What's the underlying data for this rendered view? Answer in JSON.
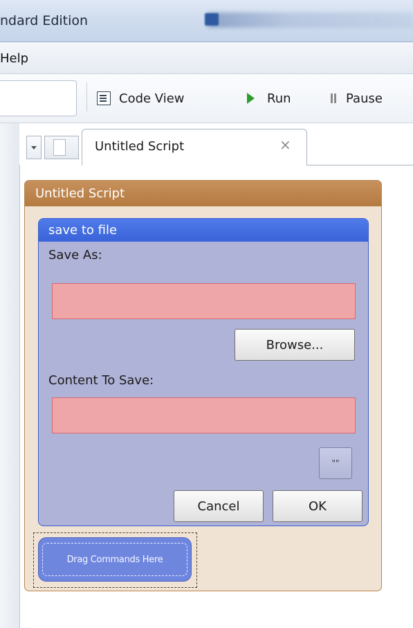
{
  "window": {
    "title": "ndard Edition"
  },
  "menu": {
    "help": "Help"
  },
  "toolbar": {
    "code_view": "Code View",
    "run": "Run",
    "pause": "Pause"
  },
  "tabs": {
    "active_label": "Untitled Script",
    "close_glyph": "×"
  },
  "script": {
    "title": "Untitled Script",
    "command": {
      "title": "save to file",
      "save_as_label": "Save As:",
      "save_as_value": "",
      "browse_label": "Browse...",
      "content_label": "Content To Save:",
      "content_value": "",
      "quote_button": "\"\"",
      "cancel_label": "Cancel",
      "ok_label": "OK"
    },
    "drop_zone": "Drag Commands Here"
  },
  "colors": {
    "script_header": "#b47a40",
    "script_body": "#f1e3d3",
    "command_header": "#3a63d9",
    "command_body": "#b0b3d8",
    "field_error": "#efa6a9",
    "drop_zone": "#6f86df",
    "run_icon": "#2e9d2e"
  },
  "icons": [
    "code-view-icon",
    "run-icon",
    "pause-icon",
    "dropdown-arrow-icon",
    "document-icon",
    "close-icon"
  ]
}
